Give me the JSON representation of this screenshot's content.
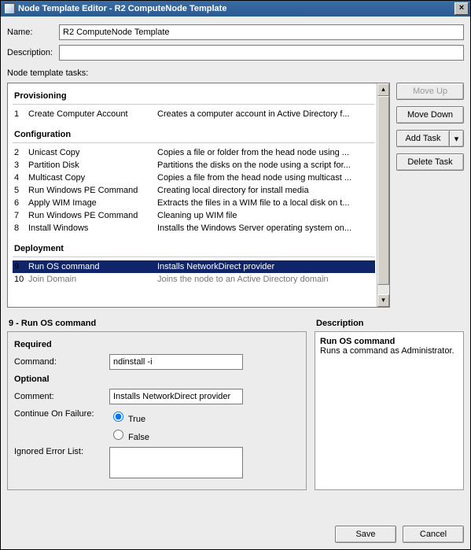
{
  "window": {
    "title": "Node Template Editor - R2 ComputeNode Template"
  },
  "form": {
    "name_label": "Name:",
    "name_value": "R2 ComputeNode Template",
    "desc_label": "Description:",
    "desc_value": ""
  },
  "tasks_label": "Node template tasks:",
  "sections": {
    "provisioning": "Provisioning",
    "configuration": "Configuration",
    "deployment": "Deployment"
  },
  "tasks": {
    "r1": {
      "num": "1",
      "name": "Create Computer Account",
      "desc": "Creates a computer account in Active Directory f..."
    },
    "r2": {
      "num": "2",
      "name": "Unicast Copy",
      "desc": "Copies a file or folder from the head node using ..."
    },
    "r3": {
      "num": "3",
      "name": "Partition Disk",
      "desc": "Partitions the disks on the node using a script for..."
    },
    "r4": {
      "num": "4",
      "name": "Multicast Copy",
      "desc": "Copies a file from the head node using multicast ..."
    },
    "r5": {
      "num": "5",
      "name": "Run Windows PE Command",
      "desc": "Creating local directory for install media"
    },
    "r6": {
      "num": "6",
      "name": "Apply WIM Image",
      "desc": "Extracts the files in a WIM file to a local disk on t..."
    },
    "r7": {
      "num": "7",
      "name": "Run Windows PE Command",
      "desc": "Cleaning up WIM file"
    },
    "r8": {
      "num": "8",
      "name": "Install Windows",
      "desc": "Installs the Windows Server operating system on..."
    },
    "r9": {
      "num": "9",
      "name": "Run OS command",
      "desc": "Installs NetworkDirect provider"
    },
    "r10": {
      "num": "10",
      "name": "Join Domain",
      "desc": "Joins the node to an Active Directory domain"
    }
  },
  "buttons": {
    "move_up": "Move Up",
    "move_down": "Move Down",
    "add_task": "Add Task",
    "delete_task": "Delete Task",
    "save": "Save",
    "cancel": "Cancel"
  },
  "detail": {
    "panel_title": "9 - Run OS command",
    "required_heading": "Required",
    "command_label": "Command:",
    "command_value": "ndinstall -i",
    "optional_heading": "Optional",
    "comment_label": "Comment:",
    "comment_value": "Installs NetworkDirect provider",
    "cof_label": "Continue On Failure:",
    "cof_true": "True",
    "cof_false": "False",
    "ignored_label": "Ignored Error List:",
    "ignored_value": ""
  },
  "description_panel": {
    "title": "Description",
    "heading": "Run OS command",
    "text": "Runs a command as Administrator."
  }
}
